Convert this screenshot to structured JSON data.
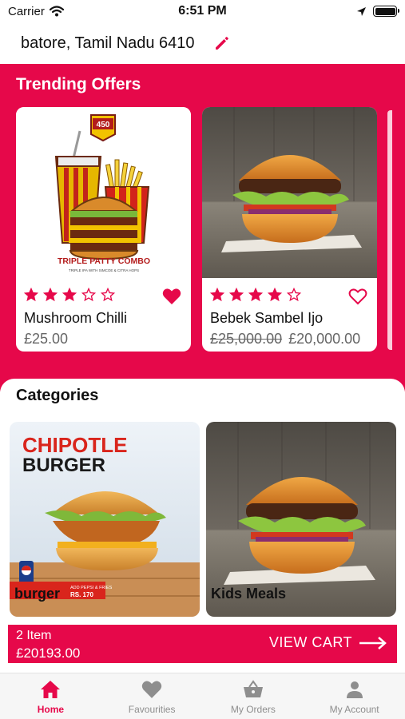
{
  "status_bar": {
    "carrier": "Carrier",
    "time": "6:51 PM"
  },
  "address": {
    "text": "batore, Tamil Nadu 6410"
  },
  "trending": {
    "title": "Trending Offers",
    "cards": [
      {
        "name": "Mushroom Chilli",
        "price": "£25.00",
        "old_price": "",
        "rating": 3,
        "favorite": true,
        "image_caption": "TRIPLE PATTY COMBO",
        "image_subcaption": "TRIPLE IPA WITH SIMCOE & CITRA HOPS",
        "badge": "450"
      },
      {
        "name": "Bebek Sambel Ijo",
        "price": "£20,000.00",
        "old_price": "£25,000.00",
        "rating": 4,
        "favorite": false
      }
    ]
  },
  "categories": {
    "title": "Categories",
    "items": [
      {
        "label": "burger",
        "poster_line1": "CHIPOTLE",
        "poster_line2": "BURGER",
        "poster_note1": "ADD PEPSI & FRIES",
        "poster_note2": "RS. 170"
      },
      {
        "label": "Kids Meals"
      }
    ]
  },
  "cart": {
    "items": "2 Item",
    "total": "£20193.00",
    "button": "VIEW CART"
  },
  "tabs": [
    {
      "label": "Home",
      "icon": "home-icon",
      "active": true
    },
    {
      "label": "Favourities",
      "icon": "heart-icon",
      "active": false
    },
    {
      "label": "My Orders",
      "icon": "basket-icon",
      "active": false
    },
    {
      "label": "My Account",
      "icon": "person-icon",
      "active": false
    }
  ],
  "colors": {
    "accent": "#e6084a",
    "inactive": "#8e8e8e"
  }
}
